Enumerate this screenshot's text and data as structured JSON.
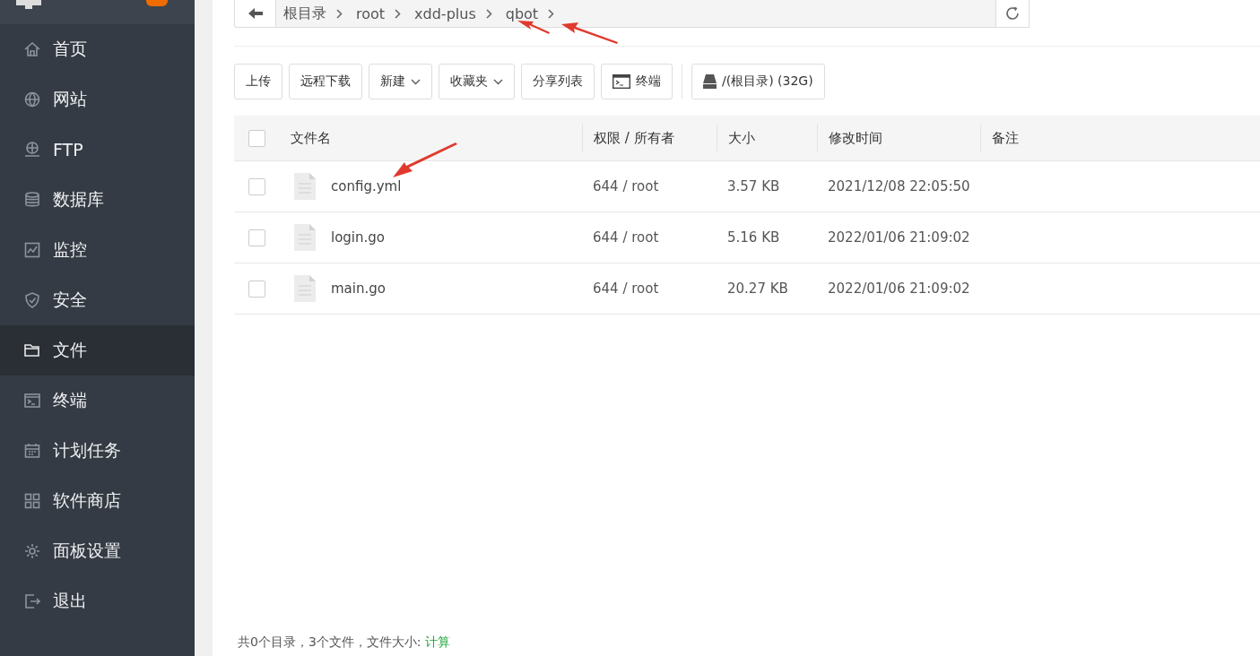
{
  "sidebar": {
    "items": [
      {
        "label": "首页",
        "selected": false
      },
      {
        "label": "网站",
        "selected": false
      },
      {
        "label": "FTP",
        "selected": false
      },
      {
        "label": "数据库",
        "selected": false
      },
      {
        "label": "监控",
        "selected": false
      },
      {
        "label": "安全",
        "selected": false
      },
      {
        "label": "文件",
        "selected": true
      },
      {
        "label": "终端",
        "selected": false
      },
      {
        "label": "计划任务",
        "selected": false
      },
      {
        "label": "软件商店",
        "selected": false
      },
      {
        "label": "面板设置",
        "selected": false
      },
      {
        "label": "退出",
        "selected": false
      }
    ]
  },
  "breadcrumb": [
    "根目录",
    "root",
    "xdd-plus",
    "qbot"
  ],
  "toolbar": [
    {
      "label": "上传",
      "kind": "plain"
    },
    {
      "label": "远程下载",
      "kind": "plain"
    },
    {
      "label": "新建",
      "kind": "dropdown"
    },
    {
      "label": "收藏夹",
      "kind": "dropdown"
    },
    {
      "label": "分享列表",
      "kind": "plain"
    },
    {
      "label": "终端",
      "kind": "terminal"
    },
    {
      "label": "/(根目录) (32G)",
      "kind": "disk"
    }
  ],
  "table": {
    "select_all_checked": false,
    "columns": [
      "文件名",
      "权限 / 所有者",
      "大小",
      "修改时间",
      "备注"
    ],
    "rows": [
      {
        "name": "config.yml",
        "perm": "644 / root",
        "size": "3.57 KB",
        "mtime": "2021/12/08 22:05:50",
        "checked": false
      },
      {
        "name": "login.go",
        "perm": "644 / root",
        "size": "5.16 KB",
        "mtime": "2022/01/06 21:09:02",
        "checked": false
      },
      {
        "name": "main.go",
        "perm": "644 / root",
        "size": "20.27 KB",
        "mtime": "2022/01/06 21:09:02",
        "checked": false
      }
    ]
  },
  "footer": {
    "summary": "共0个目录，3个文件，文件大小:",
    "link": "计算"
  }
}
